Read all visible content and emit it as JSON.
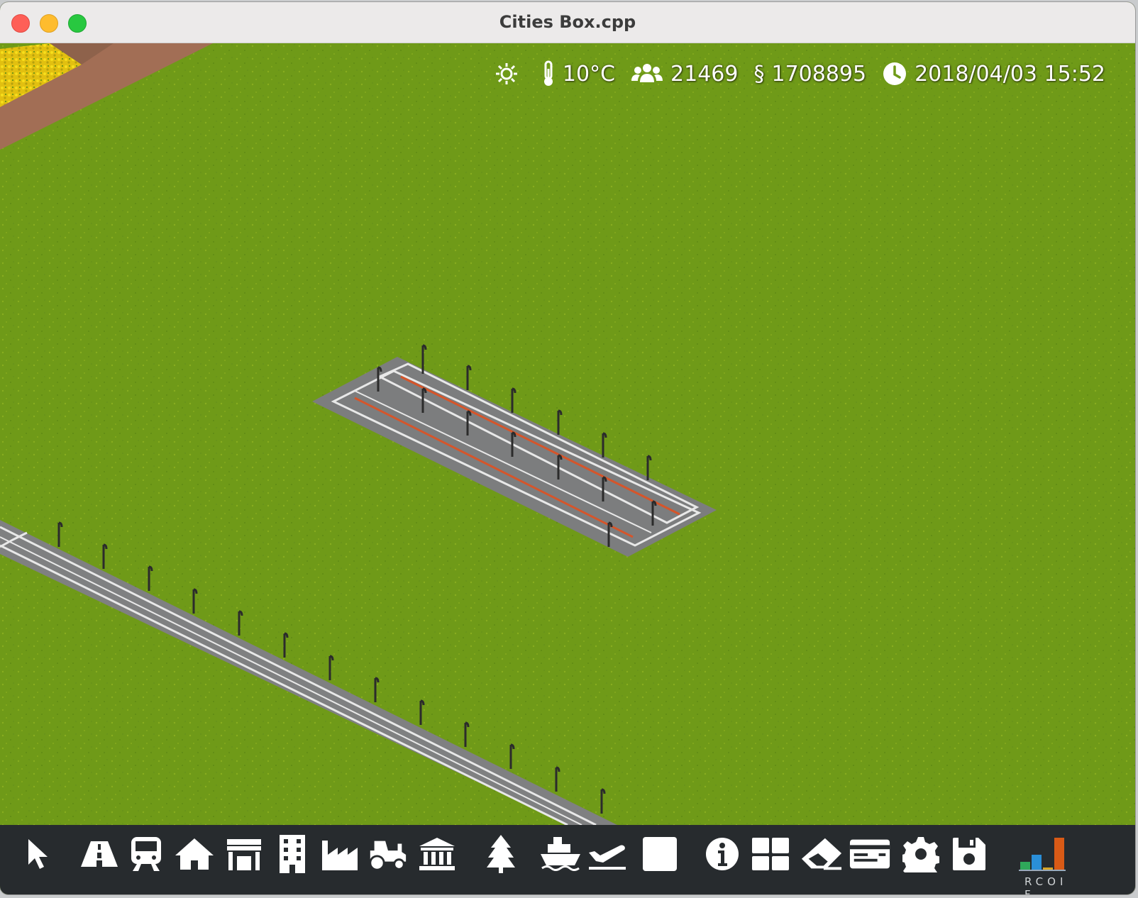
{
  "window": {
    "title": "Cities Box.cpp"
  },
  "hud": {
    "weather_icon": "sun-icon",
    "temperature": "10°C",
    "population_icon": "people-icon",
    "population": "21469",
    "money_symbol": "§",
    "money": "1708895",
    "clock_icon": "clock-icon",
    "datetime": "2018/04/03 15:52"
  },
  "toolbar": {
    "tools": [
      {
        "name": "select",
        "icon": "pointer-icon"
      },
      {
        "name": "roads",
        "icon": "road-icon"
      },
      {
        "name": "transit",
        "icon": "train-icon"
      },
      {
        "name": "residential",
        "icon": "house-icon"
      },
      {
        "name": "commercial",
        "icon": "shop-icon"
      },
      {
        "name": "office",
        "icon": "office-building-icon"
      },
      {
        "name": "industrial",
        "icon": "factory-icon"
      },
      {
        "name": "agriculture",
        "icon": "tractor-icon"
      },
      {
        "name": "services",
        "icon": "government-building-icon"
      },
      {
        "name": "parks",
        "icon": "tree-icon"
      },
      {
        "name": "harbor",
        "icon": "ship-icon"
      },
      {
        "name": "airport",
        "icon": "plane-icon"
      },
      {
        "name": "blank",
        "icon": "square-icon"
      },
      {
        "name": "info",
        "icon": "info-icon"
      },
      {
        "name": "overlays",
        "icon": "grid-icon"
      },
      {
        "name": "bulldoze",
        "icon": "eraser-icon"
      },
      {
        "name": "finance",
        "icon": "card-icon"
      },
      {
        "name": "settings",
        "icon": "gear-icon"
      },
      {
        "name": "save",
        "icon": "save-icon"
      }
    ],
    "demand_label": "RCOI F",
    "demand_colors": [
      "#2fa85a",
      "#2a8fd8",
      "#d8a628",
      "#d85a16"
    ]
  },
  "colors": {
    "grass": "#6f9a18",
    "road": "#7f8081",
    "toolbar": "#272b2e",
    "dirt": "#9b6a52"
  }
}
